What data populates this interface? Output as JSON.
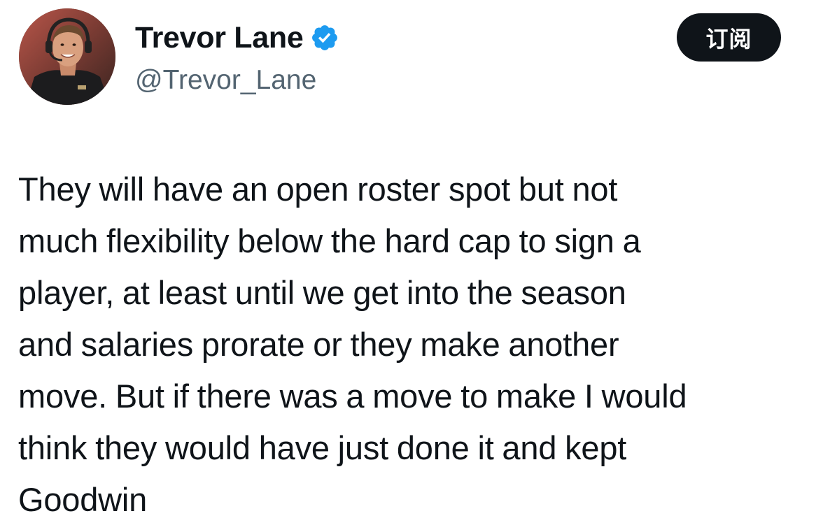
{
  "author": {
    "display_name": "Trevor Lane",
    "handle": "@Trevor_Lane",
    "verified_icon": "verified-badge-icon",
    "avatar": "avatar-photo"
  },
  "actions": {
    "subscribe_label": "订阅"
  },
  "tweet": {
    "text": "They will have an open roster spot but not\nmuch flexibility below the hard cap to sign a\nplayer, at least until we get into the season\nand salaries prorate or they make another\nmove. But if there was a move to make I would\nthink they would have just done it and kept\nGoodwin"
  },
  "colors": {
    "text_primary": "#0f1419",
    "text_secondary": "#536471",
    "verified_blue": "#1d9bf0",
    "button_bg": "#0f1419",
    "background": "#ffffff"
  }
}
